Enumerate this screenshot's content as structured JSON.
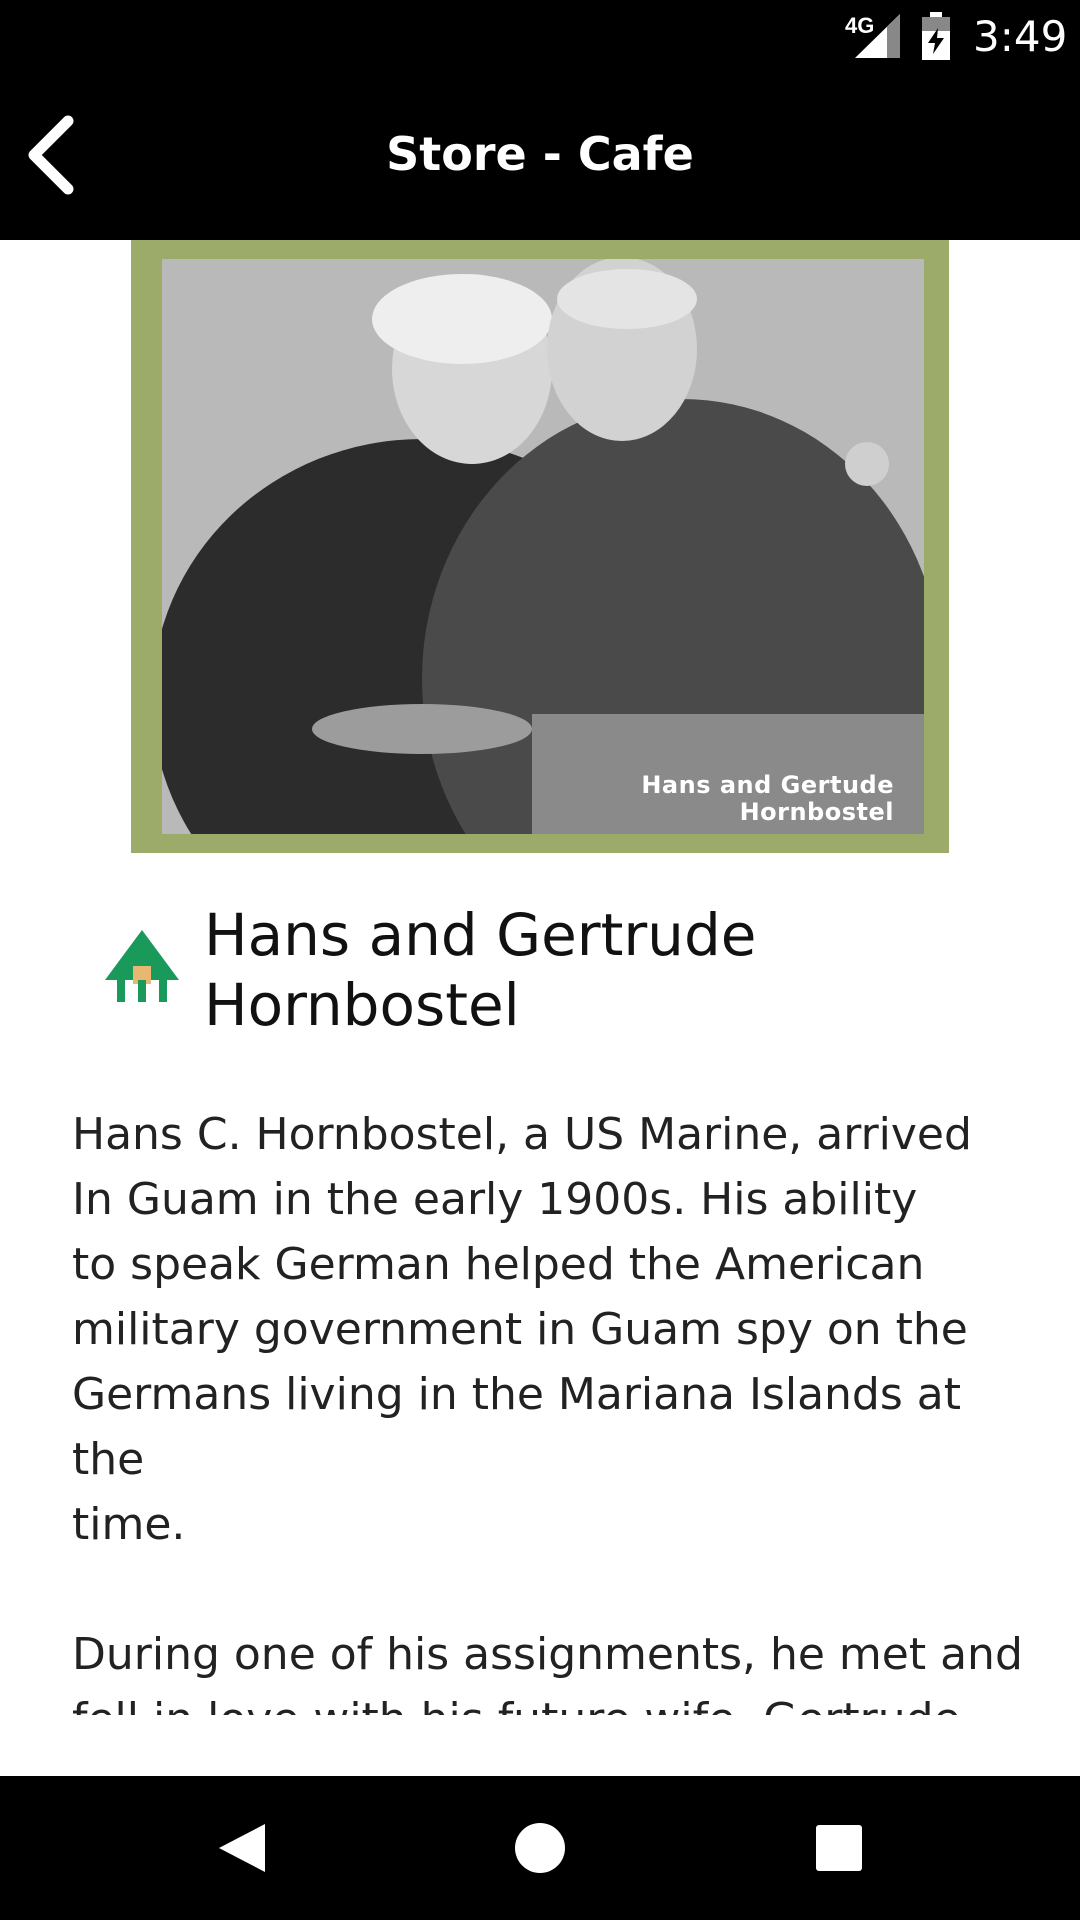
{
  "status_bar": {
    "network": "4G",
    "time": "3:49",
    "icons": [
      "signal-icon",
      "battery-charging-icon"
    ]
  },
  "app_bar": {
    "title": "Store - Cafe",
    "back_icon": "chevron-left-icon"
  },
  "place": {
    "photo_caption_line1": "Hans and Gertude",
    "photo_caption_line2": "Hornbostel",
    "title": "Hans and Gertrude Hornbostel",
    "icon": "tree-icon",
    "paragraphs": [
      "Hans C. Hornbostel, a US Marine, arrived\nIn Guam in the early 1900s. His ability\nto speak German helped the American\nmilitary government in Guam spy on the\nGermans living in the Mariana Islands at the\ntime.",
      "During one of his assignments, he met and\nfell in love with his future wife, Gertrude\nCastenoble. The couple married and"
    ]
  },
  "colors": {
    "frame": "#9dab6a",
    "tree_green": "#1a9a5a",
    "tree_trunk": "#e8b873"
  },
  "nav_bar": {
    "buttons": [
      "back-triangle-icon",
      "home-circle-icon",
      "recents-square-icon"
    ]
  }
}
